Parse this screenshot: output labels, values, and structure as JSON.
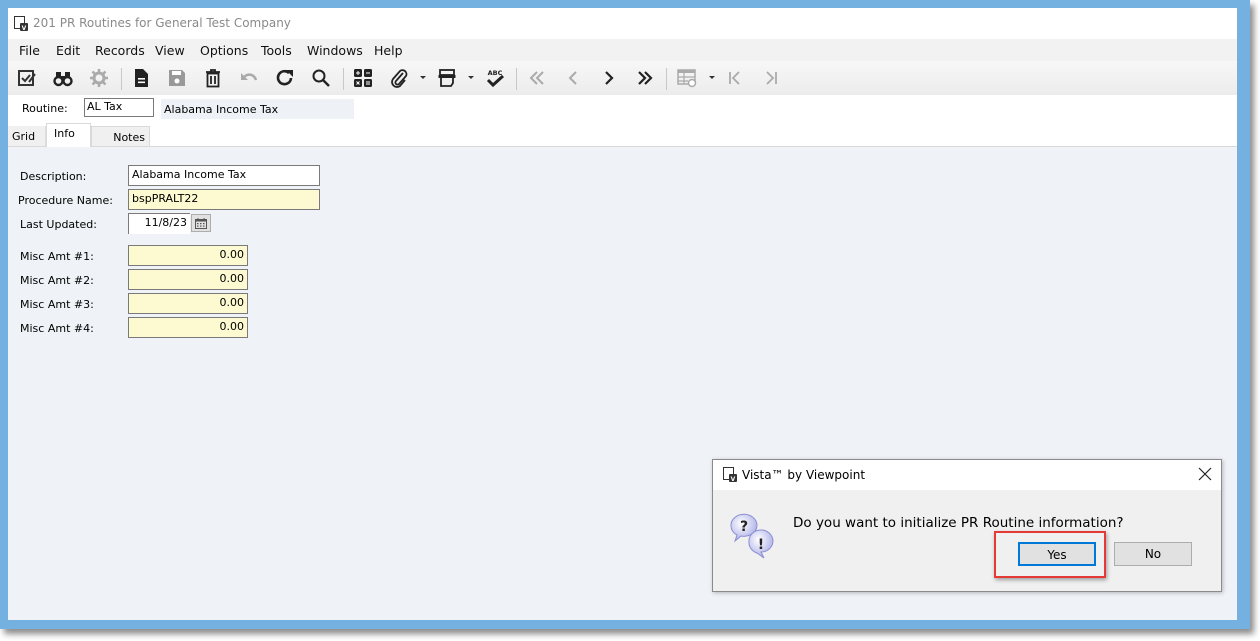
{
  "window": {
    "title": "201 PR Routines for General Test Company"
  },
  "menu": [
    "File",
    "Edit",
    "Records",
    "View",
    "Options",
    "Tools",
    "Windows",
    "Help"
  ],
  "toolbar": {
    "items": [
      {
        "name": "save-and-close-icon",
        "enabled": true
      },
      {
        "name": "find-binoculars-icon",
        "enabled": true
      },
      {
        "name": "settings-gear-icon",
        "enabled": false
      },
      {
        "name": "new-record-icon",
        "enabled": true
      },
      {
        "name": "save-icon",
        "enabled": false
      },
      {
        "name": "delete-icon",
        "enabled": true
      },
      {
        "name": "undo-icon",
        "enabled": false
      },
      {
        "name": "refresh-icon",
        "enabled": true
      },
      {
        "name": "lookup-icon",
        "enabled": true
      },
      {
        "name": "calculator-icon",
        "enabled": true
      },
      {
        "name": "attachment-icon",
        "enabled": true
      },
      {
        "name": "print-icon",
        "enabled": true
      },
      {
        "name": "spell-check-icon",
        "enabled": true
      },
      {
        "name": "first-record-icon",
        "enabled": false
      },
      {
        "name": "previous-record-icon",
        "enabled": false
      },
      {
        "name": "next-record-icon",
        "enabled": true
      },
      {
        "name": "last-record-icon",
        "enabled": true
      },
      {
        "name": "grid-settings-icon",
        "enabled": false
      },
      {
        "name": "first-page-icon",
        "enabled": false
      },
      {
        "name": "last-page-icon",
        "enabled": false
      }
    ],
    "spell_check_label": "ABC"
  },
  "header": {
    "routine_label": "Routine:",
    "routine_value": "AL Tax",
    "routine_description": "Alabama Income Tax"
  },
  "tabs": [
    {
      "label": "Grid",
      "active": false
    },
    {
      "label": "Info",
      "active": true
    },
    {
      "label": "Notes",
      "active": false
    }
  ],
  "form": {
    "description_label": "Description:",
    "description_value": "Alabama Income Tax",
    "procedure_label": "Procedure Name:",
    "procedure_value": "bspPRALT22",
    "last_updated_label": "Last Updated:",
    "last_updated_value": "11/8/23",
    "misc": [
      {
        "label": "Misc Amt #1:",
        "value": "0.00"
      },
      {
        "label": "Misc Amt #2:",
        "value": "0.00"
      },
      {
        "label": "Misc Amt #3:",
        "value": "0.00"
      },
      {
        "label": "Misc Amt #4:",
        "value": "0.00"
      }
    ]
  },
  "dialog": {
    "title": "Vista™ by Viewpoint",
    "message": "Do you want to initialize PR Routine information?",
    "yes_label": "Yes",
    "no_label": "No",
    "highlight_color": "#e53935"
  },
  "colors": {
    "frame": "#74b1e1",
    "background": "#eff3f7",
    "required_field": "#fdfad2",
    "focus_border": "#0078d7"
  }
}
